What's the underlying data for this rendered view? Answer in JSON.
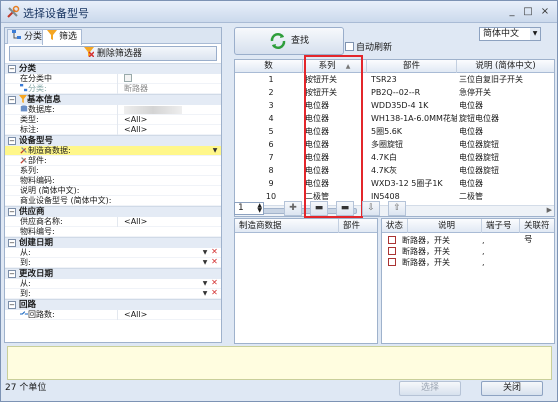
{
  "window": {
    "title": "选择设备型号",
    "min": "_",
    "max": "□",
    "close": "×"
  },
  "left_tabs": [
    {
      "label": "分类"
    },
    {
      "label": "筛选"
    }
  ],
  "clear_filter_label": "删除筛选器",
  "categories": [
    {
      "title": "分类",
      "rows": [
        {
          "key": "在分类中",
          "value": ""
        },
        {
          "key": "分类:",
          "value": "断路器"
        }
      ]
    },
    {
      "title": "基本信息",
      "rows": [
        {
          "key": "数据库:",
          "value": ""
        },
        {
          "key": "类型:",
          "value": "<All>"
        },
        {
          "key": "标注:",
          "value": "<All>"
        }
      ]
    },
    {
      "title": "设备型号",
      "rows": [
        {
          "key": "制造商数据:",
          "value": ""
        },
        {
          "key": "部件:",
          "value": ""
        },
        {
          "key": "系列:",
          "value": ""
        },
        {
          "key": "物料编码:",
          "value": ""
        },
        {
          "key": "说明 (简体中文):",
          "value": ""
        },
        {
          "key": "商业设备型号 (简体中文):",
          "value": ""
        }
      ]
    },
    {
      "title": "供应商",
      "rows": [
        {
          "key": "供应商名称:",
          "value": "<All>"
        },
        {
          "key": "物料编号:",
          "value": ""
        }
      ]
    },
    {
      "title": "创建日期",
      "rows": [
        {
          "key": "从:",
          "value": ""
        },
        {
          "key": "到:",
          "value": ""
        }
      ]
    },
    {
      "title": "更改日期",
      "rows": [
        {
          "key": "从:",
          "value": ""
        },
        {
          "key": "到:",
          "value": ""
        }
      ]
    },
    {
      "title": "回路",
      "rows": [
        {
          "key": "回路数:",
          "value": "<All>"
        }
      ]
    }
  ],
  "search_label": "查找",
  "auto_refresh_label": "自动刷新",
  "language": "简体中文",
  "grid": {
    "headers": [
      "数",
      "系列",
      "部件",
      "说明 (简体中文)"
    ],
    "rows": [
      [
        "1",
        "按钮开关",
        "TSR23",
        "三位自复旧子开关"
      ],
      [
        "2",
        "按钮开关",
        "PB2Q--02--R",
        "急停开关"
      ],
      [
        "3",
        "电位器",
        "WDD35D-4 1K",
        "电位器"
      ],
      [
        "4",
        "电位器",
        "WH138-1A-6.0MM花轴",
        "旋钮电位器"
      ],
      [
        "5",
        "电位器",
        "5圈5.6K",
        "电位器"
      ],
      [
        "6",
        "电位器",
        "多圈旋钮",
        "电位器旋钮"
      ],
      [
        "7",
        "电位器",
        "4.7K白",
        "电位器旋钮"
      ],
      [
        "8",
        "电位器",
        "4.7K灰",
        "电位器旋钮"
      ],
      [
        "9",
        "电位器",
        "WXD3-12 5圈子1K",
        "电位器"
      ],
      [
        "10",
        "二极管",
        "IN5408",
        "二极管"
      ]
    ]
  },
  "nav": {
    "page": "1"
  },
  "sub_left_headers": [
    "制造商数据",
    "部件"
  ],
  "sub_right_headers": [
    "状态",
    "说明",
    "端子号",
    "关联符号"
  ],
  "sub_right_rows": [
    {
      "desc": "断路器，开关",
      "term": ","
    },
    {
      "desc": "断路器，开关",
      "term": ","
    },
    {
      "desc": "断路器，开关",
      "term": ","
    }
  ],
  "status_text": "27 个单位",
  "select_label": "选择",
  "close_label": "关闭",
  "colors": {
    "highlight": "#fff78a",
    "red_box": "#e3262b",
    "accent": "#15325f"
  }
}
